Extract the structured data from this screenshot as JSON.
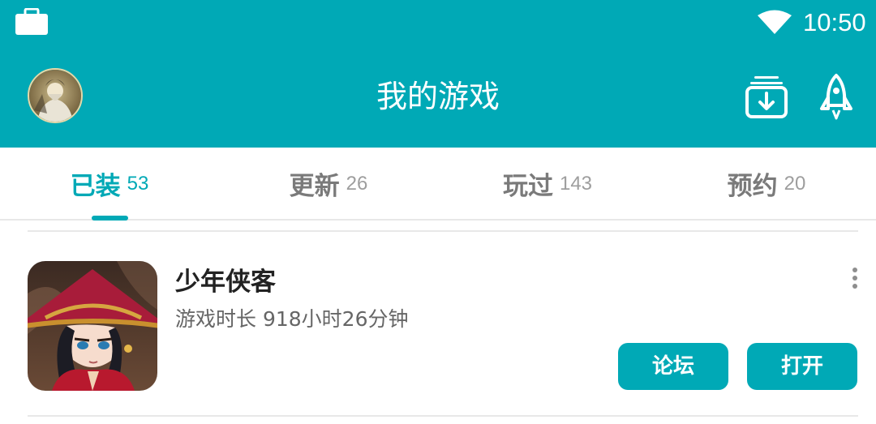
{
  "status_bar": {
    "time": "10:50",
    "icons": [
      "briefcase-icon",
      "wifi-icon"
    ]
  },
  "app_bar": {
    "title": "我的游戏",
    "icons": [
      "avatar",
      "download-manager-icon",
      "rocket-icon"
    ]
  },
  "tabs": [
    {
      "label": "已装",
      "count": "53",
      "active": true
    },
    {
      "label": "更新",
      "count": "26",
      "active": false
    },
    {
      "label": "玩过",
      "count": "143",
      "active": false
    },
    {
      "label": "预约",
      "count": "20",
      "active": false
    }
  ],
  "game": {
    "name": "少年侠客",
    "playtime": "游戏时长 918小时26分钟",
    "forum_label": "论坛",
    "open_label": "打开"
  },
  "colors": {
    "accent": "#00a9b6",
    "tab_inactive": "#7a7a7a",
    "divider": "#e8e8e8"
  }
}
